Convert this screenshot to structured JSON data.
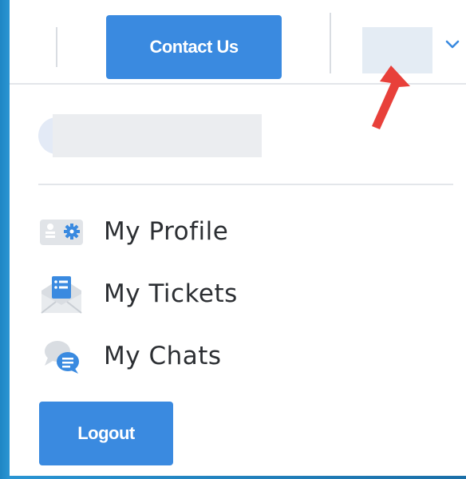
{
  "header": {
    "contact_label": "Contact Us",
    "avatar_icon": "avatar-placeholder",
    "dropdown_icon": "chevron-down-icon"
  },
  "annotation": {
    "icon": "red-arrow-icon",
    "color": "#e8403a"
  },
  "menu": {
    "items": [
      {
        "label": "My Profile",
        "icon": "profile-settings-icon"
      },
      {
        "label": "My Tickets",
        "icon": "tickets-icon"
      },
      {
        "label": "My Chats",
        "icon": "chats-icon"
      }
    ],
    "logout_label": "Logout"
  },
  "colors": {
    "accent": "#3a8ae0",
    "text": "#2c2f33",
    "background_edge": "#1f86c4"
  }
}
